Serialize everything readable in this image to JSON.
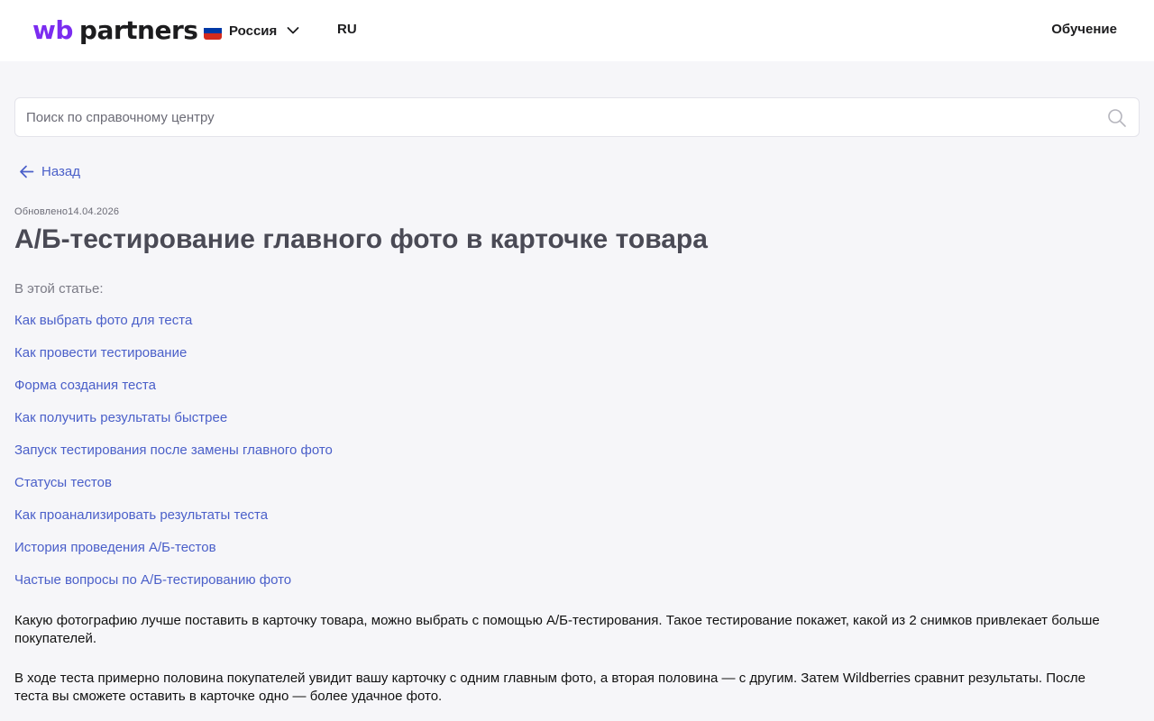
{
  "header": {
    "logo": {
      "wb": "wb",
      "partners": "partners"
    },
    "region": {
      "label": "Россия",
      "flag_colors": [
        "#ffffff",
        "#0039a6",
        "#d52b1e"
      ]
    },
    "language": "RU",
    "training_link": "Обучение"
  },
  "search": {
    "placeholder": "Поиск по справочному центру",
    "value": ""
  },
  "back_link": "Назад",
  "article": {
    "updated_label": "Обновлено",
    "updated_date": "14.04.2026",
    "title": "А/Б-тестирование главного фото в карточке товара",
    "toc_heading": "В этой статье:",
    "toc": [
      "Как выбрать фото для теста",
      "Как провести тестирование",
      "Форма создания теста",
      "Как получить результаты быстрее",
      "Запуск тестирования после замены главного фото",
      "Статусы тестов",
      "Как проанализировать результаты теста",
      "История проведения А/Б-тестов",
      "Частые вопросы по А/Б-тестированию фото"
    ],
    "paragraphs": [
      "Какую фотографию лучше поставить в карточку товара, можно выбрать с помощью А/Б-тестирования. Такое тестирование покажет, какой из 2 снимков привлекает больше покупателей.",
      "В ходе теста примерно половина покупателей увидит вашу карточку с одним главным фото, а вторая половина — с другим. Затем Wildberries сравнит результаты. После теста вы сможете оставить в карточке одно — более удачное фото."
    ]
  },
  "colors": {
    "brand": "#7b2cf0",
    "link": "#4a5fc9",
    "background": "#f6f6f9"
  }
}
